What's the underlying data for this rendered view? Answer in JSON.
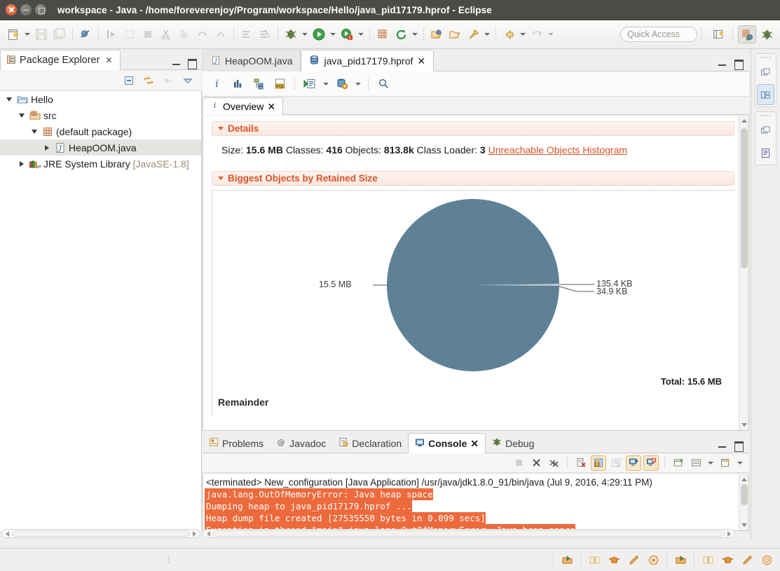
{
  "window": {
    "title": "workspace - Java - /home/foreverenjoy/Program/workspace/Hello/java_pid17179.hprof - Eclipse",
    "close_label": "×",
    "minimize_label": "–",
    "maximize_label": "□"
  },
  "toolbar": {
    "quick_access_placeholder": "Quick Access",
    "icons": [
      "new-wizard-icon",
      "new-wizard-dropdown",
      "save-icon",
      "save-all-icon",
      "toggle-breakpoint-icon",
      "step-into-icon",
      "step-over-icon",
      "terminate-icon",
      "cut-icon",
      "paste-icon",
      "undo-icon",
      "redo-icon",
      "skip-breakpoints-icon",
      "remove-breakpoints-icon",
      "debug-icon",
      "debug-dropdown",
      "run-icon",
      "run-dropdown",
      "external-tools-icon",
      "external-tools-dropdown",
      "new-java-package-icon",
      "refresh-icon",
      "refresh-dropdown",
      "open-type-icon",
      "open-task-icon",
      "pin-icon",
      "pin-dropdown",
      "back-icon",
      "back-dropdown",
      "forward-icon",
      "forward-dropdown"
    ]
  },
  "perspective_bar": {
    "open_perspective": "open-perspective-icon",
    "items": [
      {
        "name": "java-perspective-icon",
        "active": true
      },
      {
        "name": "debug-perspective-icon",
        "active": false
      }
    ]
  },
  "package_explorer": {
    "tab_label": "Package Explorer",
    "tab_close": "✕",
    "minimize": "minimize-icon",
    "maximize": "maximize-icon",
    "toolbar_icons": [
      "collapse-all-icon",
      "link-with-editor-icon",
      "focus-icon",
      "view-menu-icon"
    ],
    "tree": [
      {
        "label": "Hello",
        "indent": 0,
        "expanded": true,
        "icon": "java-project-icon",
        "selected": false
      },
      {
        "label": "src",
        "indent": 1,
        "expanded": true,
        "icon": "source-folder-icon",
        "selected": false
      },
      {
        "label": "(default package)",
        "indent": 2,
        "expanded": true,
        "icon": "package-icon",
        "selected": false
      },
      {
        "label": "HeapOOM.java",
        "indent": 3,
        "expanded": false,
        "icon": "java-file-icon",
        "selected": true
      },
      {
        "label": "JRE System Library",
        "suffix": " [JavaSE-1.8]",
        "indent": 1,
        "expanded": false,
        "icon": "jre-library-icon",
        "selected": false
      }
    ]
  },
  "editor": {
    "tabs": [
      {
        "label": "HeapOOM.java",
        "icon": "java-file-icon",
        "active": false,
        "closable": false
      },
      {
        "label": "java_pid17179.hprof",
        "icon": "heap-dump-icon",
        "active": true,
        "closable": true,
        "close": "✕"
      }
    ],
    "minimize": "minimize-icon",
    "maximize": "maximize-icon",
    "toolbar_icons": [
      "overview-info-icon",
      "histogram-icon",
      "dominator-tree-icon",
      "oql-icon",
      "run-expert-system-icon",
      "run-expert-dropdown",
      "query-browser-icon",
      "query-browser-dropdown",
      "search-icon"
    ],
    "inner_tab": {
      "label": "Overview",
      "icon": "info-icon",
      "close": "✕"
    }
  },
  "overview": {
    "details": {
      "section_title": "Details",
      "size_label": "Size:",
      "size_value": "15.6 MB",
      "classes_label": "Classes:",
      "classes_value": "416",
      "objects_label": "Objects:",
      "objects_value": "813.8k",
      "classloader_label": "Class Loader:",
      "classloader_value": "3",
      "link": "Unreachable Objects Histogram"
    },
    "biggest_objects": {
      "section_title": "Biggest Objects by Retained Size",
      "remainder_label": "Remainder",
      "total_label": "Total: 15.6 MB"
    }
  },
  "chart_data": {
    "type": "pie",
    "title": "Biggest Objects by Retained Size",
    "labels": [
      "15.5 MB",
      "135.4 KB",
      "34.9 KB"
    ],
    "values": [
      15.5,
      0.1354,
      0.0349
    ],
    "units": "MB",
    "total": "Total: 15.6 MB",
    "colors": [
      "#5e8196",
      "#cfd6da",
      "#bfc8ce"
    ],
    "legend": "none",
    "remainder": "Remainder"
  },
  "console_panel": {
    "tabs": [
      {
        "label": "Problems",
        "icon": "problems-icon",
        "active": false
      },
      {
        "label": "Javadoc",
        "icon": "javadoc-icon",
        "active": false
      },
      {
        "label": "Declaration",
        "icon": "declaration-icon",
        "active": false
      },
      {
        "label": "Console",
        "icon": "console-icon",
        "active": true,
        "close": "✕"
      },
      {
        "label": "Debug",
        "icon": "debug-icon",
        "active": false
      }
    ],
    "minimize": "minimize-icon",
    "maximize": "maximize-icon",
    "toolbar_icons": [
      "terminate-icon",
      "remove-launch-icon",
      "remove-all-launches-icon",
      "clear-console-icon",
      "scroll-lock-icon",
      "word-wrap-icon",
      "show-console-on-output-icon",
      "show-console-on-error-icon",
      "pin-console-icon",
      "display-selected-console-icon",
      "display-selected-console-dropdown",
      "open-console-icon",
      "open-console-dropdown"
    ],
    "output": [
      {
        "text": "<terminated> New_configuration [Java Application] /usr/java/jdk1.8.0_91/bin/java (Jul 9, 2016, 4:29:11 PM)",
        "type": "header"
      },
      {
        "text": "java.lang.OutOfMemoryError: Java heap space",
        "type": "error"
      },
      {
        "text": "Dumping heap to java_pid17179.hprof ...",
        "type": "error"
      },
      {
        "text": "Heap dump file created [27535550 bytes in 0.099 secs]",
        "type": "error"
      },
      {
        "text": "Exception in thread \"main\" java.lang.OutOfMemoryError: Java heap space",
        "type": "error"
      }
    ]
  },
  "status_bar": {
    "left_icons": [
      "resize-grip-icon"
    ],
    "right_groups": [
      [
        "smart-insert-icon",
        "book-icon",
        "mortarboard-icon",
        "pencil-icon",
        "target-icon"
      ],
      [
        "smart-insert-icon",
        "book-icon",
        "mortarboard-icon",
        "pencil-icon",
        "target-icon"
      ]
    ]
  }
}
